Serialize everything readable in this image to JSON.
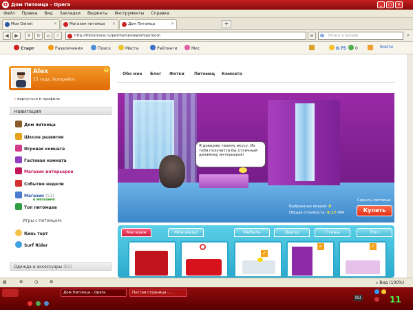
{
  "window": {
    "title": "Дом Питомца - Opera"
  },
  "menu": [
    "Файл",
    "Правка",
    "Вид",
    "Закладки",
    "Виджеты",
    "Инструменты",
    "Справка"
  ],
  "tabs": [
    {
      "label": "Мои Dalnet"
    },
    {
      "label": "Магазин питомца"
    },
    {
      "label": "Дом Питомца"
    }
  ],
  "address": {
    "url": "http://fotostrana.ru/pet/homeview/shop/room"
  },
  "search": {
    "placeholder": "Поиск в Google"
  },
  "bookmarks": {
    "start": "Старт",
    "items": [
      "Развлечения",
      "Поиск",
      "Места",
      "Рейтинги",
      "Мис"
    ],
    "balance": "0.75",
    "count": "0",
    "login": "Войти"
  },
  "profile": {
    "name": "Alex",
    "age": "23 года, Ускорийск"
  },
  "back_link": "вернуться в профиль",
  "nav": {
    "header": "Навигация",
    "items": [
      {
        "label": "Дом питомца",
        "color": "#8b5a2b"
      },
      {
        "label": "Школа развития",
        "color": "#e8a21b"
      },
      {
        "label": "Игровая комната",
        "color": "#d43b8a"
      },
      {
        "label": "Гостевая комната",
        "color": "#8f3fbf"
      },
      {
        "label": "Магазин интерьеров",
        "color": "#c2185b"
      },
      {
        "label": "Событие недели",
        "color": "#d32f2f"
      },
      {
        "label": "Магазин",
        "color": "#4b7bd0"
      },
      {
        "label": "Топ питомцев",
        "color": "#2f9e44"
      }
    ],
    "shop_count": "(51)",
    "sub": "в магазине"
  },
  "games": {
    "header": "Игры с питомцем:",
    "items": [
      "Кинь торт",
      "Surf Rider"
    ]
  },
  "clothes": {
    "header": "Одежда и аксессуары",
    "count": "(81)"
  },
  "page_tabs": [
    "Обо мне",
    "Блог",
    "Фотки",
    "Питомец",
    "Комната"
  ],
  "scene": {
    "bubble": "Я доверяю твоему вкусу. Из тебя получится бы отличный дизайнер интерьеров!",
    "hide_pet": "Скрыть питомца",
    "chosen_label": "Выбранных вещей:",
    "chosen_value": "8",
    "total_label": "Общая стоимость:",
    "total_value": "6.17",
    "total_unit": "ФМ",
    "buy": "Купить"
  },
  "shop": {
    "tabs": [
      "Магазин",
      "Мои вещи",
      "Мебель",
      "Декор",
      "Стены",
      "Пол"
    ]
  },
  "status": {
    "zoom": "Вид (100%)"
  },
  "taskbar": {
    "tasks": [
      "Дом Питомца - Opera",
      "Пустая страница - ..."
    ],
    "lang": "RU",
    "clock": "11"
  }
}
